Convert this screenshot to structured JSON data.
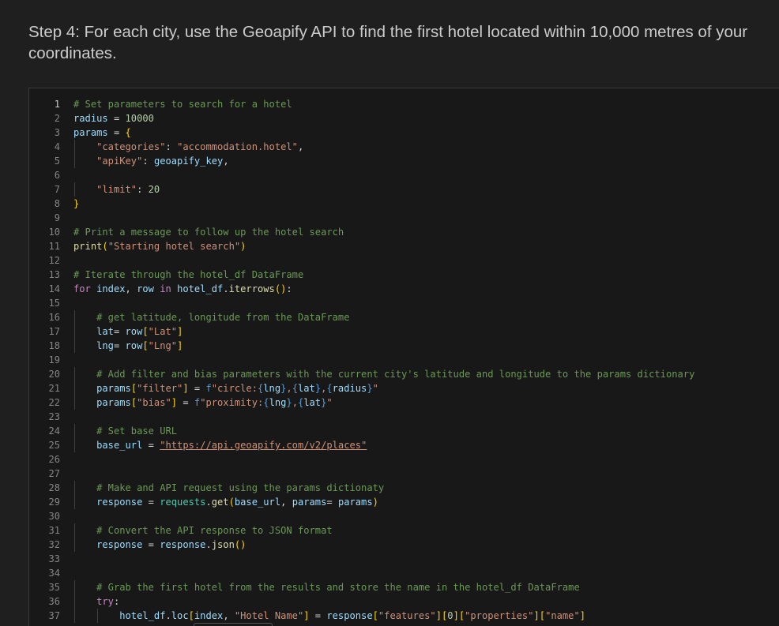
{
  "markdown": {
    "heading": "Step 4: For each city, use the Geoapify API to find the first hotel located within 10,000 metres of your coordinates."
  },
  "code": {
    "line_numbers": [
      "1",
      "2",
      "3",
      "4",
      "5",
      "6",
      "7",
      "8",
      "9",
      "10",
      "11",
      "12",
      "13",
      "14",
      "15",
      "16",
      "17",
      "18",
      "19",
      "20",
      "21",
      "22",
      "23",
      "24",
      "25",
      "26",
      "27",
      "28",
      "29",
      "30",
      "31",
      "32",
      "33",
      "34",
      "35",
      "36",
      "37"
    ],
    "comments": {
      "l1": "# Set parameters to search for a hotel",
      "l10": "# Print a message to follow up the hotel search",
      "l13": "# Iterate through the hotel_df DataFrame",
      "l16": "# get latitude, longitude from the DataFrame",
      "l20": "# Add filter and bias parameters with the current city's latitude and longitude to the params dictionary",
      "l24": "# Set base URL",
      "l28": "# Make and API request using the params dictionaty",
      "l31": "# Convert the API response to JSON format",
      "l35": "# Grab the first hotel from the results and store the name in the hotel_df DataFrame"
    },
    "tokens": {
      "radius": "radius",
      "radius_value": "10000",
      "params": "params",
      "categories_key": "\"categories\"",
      "categories_value": "\"accommodation.hotel\"",
      "apikey_key": "\"apiKey\"",
      "geoapify_key": "geoapify_key",
      "limit_key": "\"limit\"",
      "limit_value": "20",
      "print": "print",
      "print_msg": "\"Starting hotel search\"",
      "for": "for",
      "in": "in",
      "index": "index",
      "row": "row",
      "hotel_df": "hotel_df",
      "iterrows": "iterrows",
      "lat": "lat",
      "lng": "lng",
      "lat_key": "\"Lat\"",
      "lng_key": "\"Lng\"",
      "filter_key": "\"filter\"",
      "bias_key": "\"bias\"",
      "f_prefix": "f",
      "circle_str": "\"circle:",
      "proximity_str": "\"proximity:",
      "base_url": "base_url",
      "url": "\"https://api.geoapify.com/v2/places\"",
      "response": "response",
      "requests": "requests",
      "get": "get",
      "json": "json",
      "try": "try",
      "loc": "loc",
      "hotel_name_key": "\"Hotel Name\"",
      "features_key": "\"features\"",
      "zero": "0",
      "properties_key": "\"properties\"",
      "name_key": "\"name\""
    }
  }
}
